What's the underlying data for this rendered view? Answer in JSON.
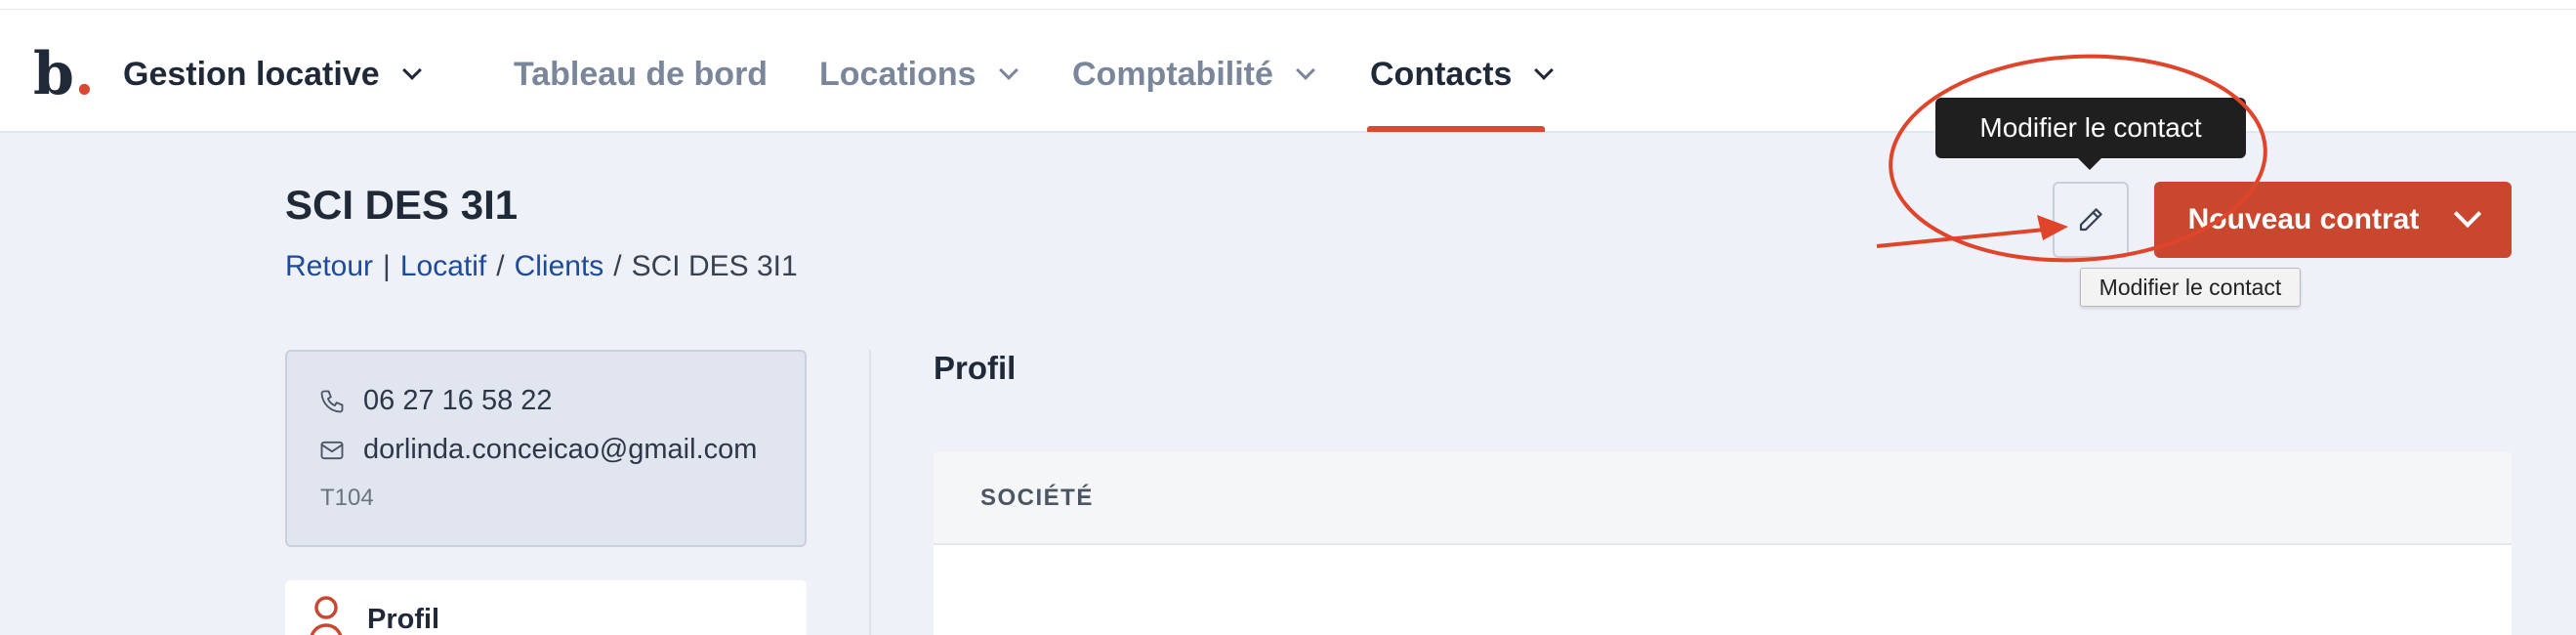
{
  "nav": {
    "logo_letter": "b",
    "logo_dot": ".",
    "brand": "Gestion locative",
    "items": [
      {
        "label": "Tableau de bord",
        "has_dropdown": false,
        "active": false
      },
      {
        "label": "Locations",
        "has_dropdown": true,
        "active": false
      },
      {
        "label": "Comptabilité",
        "has_dropdown": true,
        "active": false
      },
      {
        "label": "Contacts",
        "has_dropdown": true,
        "active": true
      }
    ]
  },
  "header": {
    "title": "SCI DES 3I1",
    "breadcrumb": {
      "back": "Retour",
      "divider": "|",
      "sep": "/",
      "crumbs": [
        "Locatif",
        "Clients"
      ],
      "current": "SCI DES 3I1"
    },
    "edit_tooltip": "Modifier le contact",
    "edit_native_tooltip": "Modifier le contact",
    "new_contract_label": "Nouveau contrat"
  },
  "contact": {
    "phone": "06 27 16 58 22",
    "email": "dorlinda.conceicao@gmail.com",
    "reference": "T104"
  },
  "sidebar": {
    "profile_label": "Profil"
  },
  "main": {
    "section_title": "Profil",
    "panel_header": "SOCIÉTÉ"
  },
  "colors": {
    "accent": "#d9482f",
    "button": "#c9472f",
    "link": "#1e4a9a",
    "background": "#eef1f8"
  },
  "icons": {
    "edit": "pencil-icon",
    "phone": "phone-icon",
    "email": "mail-icon",
    "profile": "user-icon",
    "dropdown": "chevron-down-icon"
  }
}
